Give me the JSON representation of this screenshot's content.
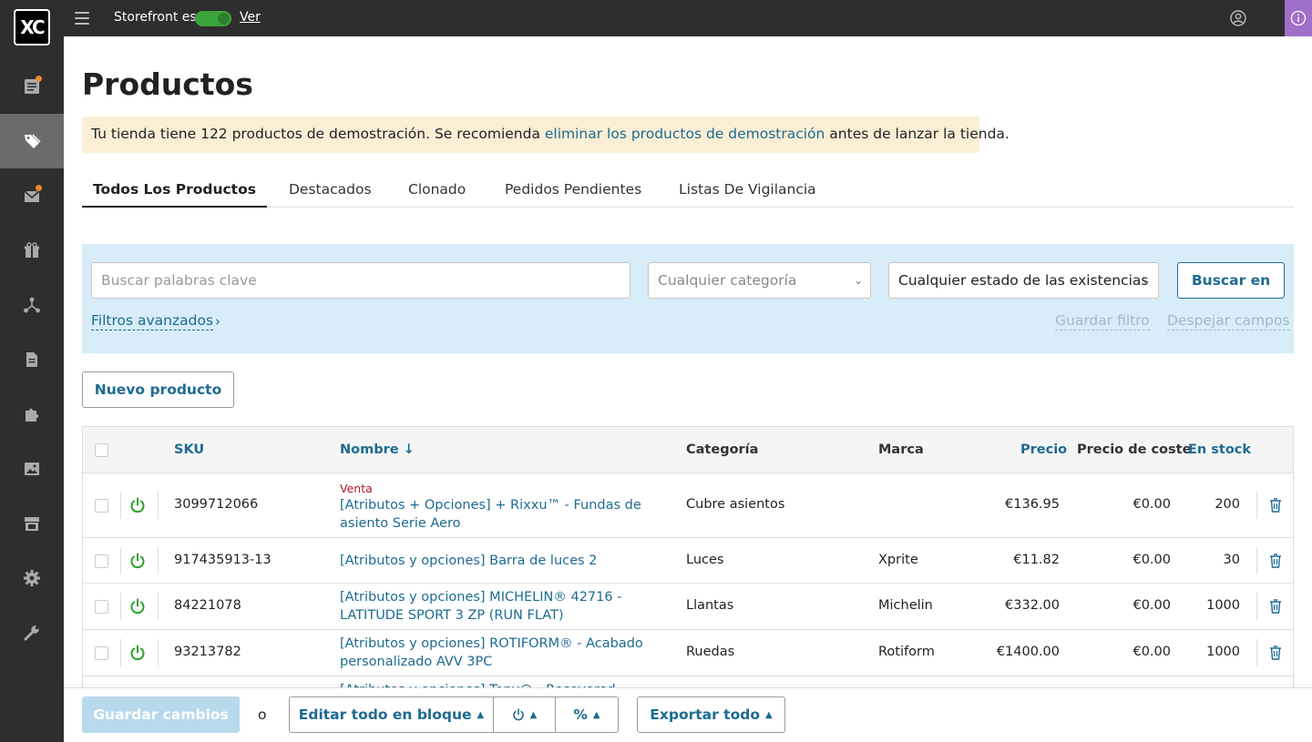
{
  "topbar": {
    "logo_text": "XC",
    "storefront_label": "Storefront es",
    "view_link": "Ver",
    "info_glyph": "ⓘ"
  },
  "sidebar": {
    "items": [
      {
        "icon": "orders-icon",
        "badge": true
      },
      {
        "icon": "tag-icon",
        "active": true
      },
      {
        "icon": "envelope-icon",
        "badge": true
      },
      {
        "icon": "gift-icon"
      },
      {
        "icon": "network-icon"
      },
      {
        "icon": "document-icon"
      },
      {
        "icon": "puzzle-icon"
      },
      {
        "icon": "image-icon"
      },
      {
        "icon": "store-icon"
      },
      {
        "icon": "gear-icon"
      },
      {
        "icon": "wrench-icon"
      }
    ]
  },
  "page": {
    "title": "Productos",
    "notice": {
      "before": "Tu tienda tiene 122 productos de demostración. Se recomienda ",
      "link": "eliminar los productos de demostración",
      "after": " antes de lanzar la tienda."
    }
  },
  "tabs": [
    {
      "label": "Todos Los Productos",
      "active": true
    },
    {
      "label": "Destacados"
    },
    {
      "label": "Clonado"
    },
    {
      "label": "Pedidos Pendientes"
    },
    {
      "label": "Listas De Vigilancia"
    }
  ],
  "search": {
    "keywords_placeholder": "Buscar palabras clave",
    "category_value": "Cualquier categoría",
    "stock_value": "Cualquier estado de las existencias",
    "search_button": "Buscar en",
    "advanced_filters": "Filtros avanzados",
    "save_filter": "Guardar filtro",
    "clear_fields": "Despejar campos"
  },
  "actions": {
    "new_product": "Nuevo producto"
  },
  "table": {
    "columns": {
      "sku": "SKU",
      "name": "Nombre",
      "name_sort": "↓",
      "category": "Categoría",
      "brand": "Marca",
      "price": "Precio",
      "cost": "Precio de coste",
      "stock": "En stock"
    },
    "rows": [
      {
        "sale": "Venta",
        "sku": "3099712066",
        "name": "[Atributos + Opciones] + Rixxu™ - Fundas de asiento Serie Aero",
        "category": "Cubre asientos",
        "brand": "",
        "price": "€136.95",
        "cost": "€0.00",
        "stock": "200"
      },
      {
        "sku": "917435913-13",
        "name": "[Atributos y opciones] Barra de luces 2",
        "category": "Luces",
        "brand": "Xprite",
        "price": "€11.82",
        "cost": "€0.00",
        "stock": "30"
      },
      {
        "sku": "84221078",
        "name": "[Atributos y opciones] MICHELIN® 42716 - LATITUDE SPORT 3 ZP (RUN FLAT)",
        "category": "Llantas",
        "brand": "Michelin",
        "price": "€332.00",
        "cost": "€0.00",
        "stock": "1000"
      },
      {
        "sku": "93213782",
        "name": "[Atributos y opciones] ROTIFORM® - Acabado personalizado AVV 3PC",
        "category": "Ruedas",
        "brand": "Rotiform",
        "price": "€1400.00",
        "cost": "€0.00",
        "stock": "1000"
      },
      {
        "sku": "",
        "name": "[Atributos y opciones] Tony@ - Recovered",
        "category": "",
        "brand": "",
        "price": "",
        "cost": "",
        "stock": ""
      }
    ]
  },
  "bottom": {
    "save_changes": "Guardar cambios",
    "or": "o",
    "bulk_edit": "Editar todo en bloque",
    "export_all": "Exportar todo",
    "percent_glyph": "%"
  },
  "colors": {
    "accent": "#1d6b91",
    "sidebar": "#2e2e2e",
    "notice_bg": "#faeed5",
    "search_bg": "#d8ecf9",
    "power_green": "#2ca02c",
    "sale_red": "#b0172e",
    "badge_orange": "#ef8a2f"
  }
}
